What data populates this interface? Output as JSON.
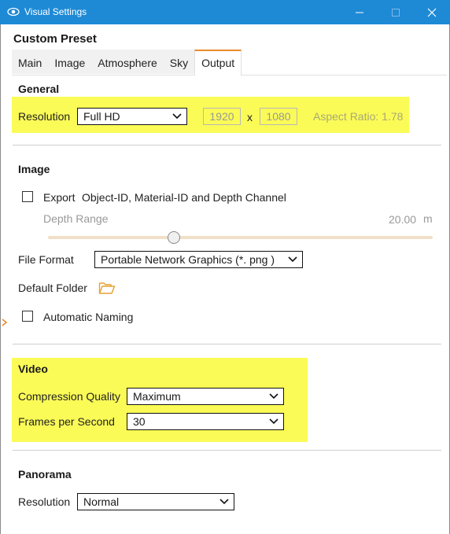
{
  "window": {
    "title": "Visual Settings"
  },
  "preset_title": "Custom Preset",
  "tabs": [
    {
      "label": "Main"
    },
    {
      "label": "Image"
    },
    {
      "label": "Atmosphere"
    },
    {
      "label": "Sky"
    },
    {
      "label": "Output",
      "active": true
    }
  ],
  "general": {
    "heading": "General",
    "resolution_label": "Resolution",
    "resolution_value": "Full HD",
    "width": "1920",
    "times": "x",
    "height": "1080",
    "aspect_ratio": "Aspect Ratio: 1.78"
  },
  "image": {
    "heading": "Image",
    "export_label": "Export",
    "export_desc": "Object-ID, Material-ID and Depth Channel",
    "export_checked": false,
    "depth_range_label": "Depth Range",
    "depth_range_value": "20.00",
    "depth_range_unit": "m",
    "depth_range_level": 0.33,
    "file_format_label": "File Format",
    "file_format_value": "Portable Network Graphics  (*. png )",
    "default_folder_label": "Default Folder",
    "auto_naming_label": "Automatic Naming",
    "auto_naming_checked": false
  },
  "video": {
    "heading": "Video",
    "compression_label": "Compression Quality",
    "compression_value": "Maximum",
    "fps_label": "Frames per Second",
    "fps_value": "30"
  },
  "panorama": {
    "heading": "Panorama",
    "resolution_label": "Resolution",
    "resolution_value": "Normal"
  },
  "colors": {
    "titlebar": "#1e8ad6",
    "highlight": "#fbfb57",
    "accent": "#e88a2c"
  },
  "icons": {
    "app": "eye-icon",
    "minimize": "minimize-icon",
    "maximize": "maximize-icon",
    "close": "close-icon",
    "folder": "folder-icon",
    "expander": "chevron-right-icon",
    "dropdown": "chevron-down-icon"
  }
}
